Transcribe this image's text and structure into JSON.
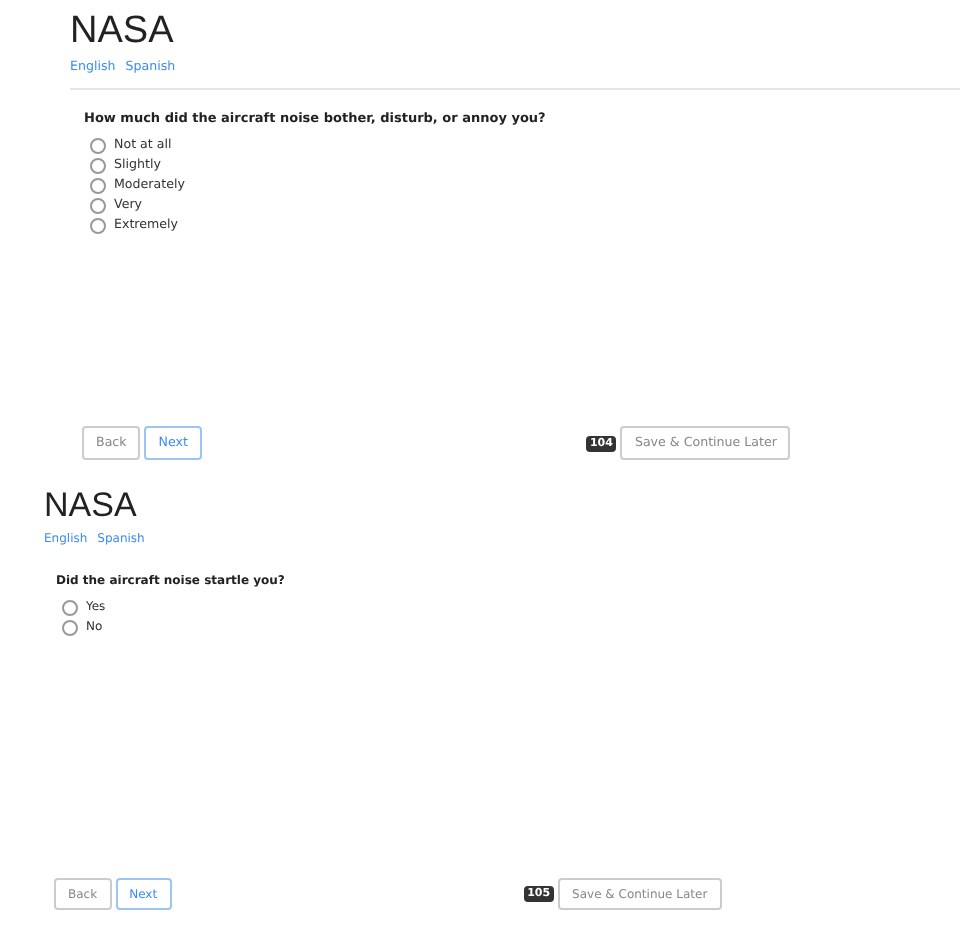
{
  "pages": [
    {
      "kind": "wide",
      "title": "NASA",
      "languages": [
        {
          "label": "English"
        },
        {
          "label": "Spanish"
        }
      ],
      "question": "How much did the aircraft noise bother, disturb, or annoy you?",
      "options": [
        {
          "label": "Not at all",
          "selected": false
        },
        {
          "label": "Slightly",
          "selected": false
        },
        {
          "label": "Moderately",
          "selected": false
        },
        {
          "label": "Very",
          "selected": false
        },
        {
          "label": "Extremely",
          "selected": false
        }
      ],
      "back": "Back",
      "next": "Next",
      "badge": "104",
      "save": "Save & Continue Later"
    },
    {
      "kind": "narrow",
      "title": "NASA",
      "languages": [
        {
          "label": "English"
        },
        {
          "label": "Spanish"
        }
      ],
      "question": "Did the aircraft noise startle you?",
      "options": [
        {
          "label": "Yes",
          "selected": false
        },
        {
          "label": "No",
          "selected": false
        }
      ],
      "back": "Back",
      "next": "Next",
      "badge": "105",
      "save": "Save & Continue Later"
    }
  ]
}
